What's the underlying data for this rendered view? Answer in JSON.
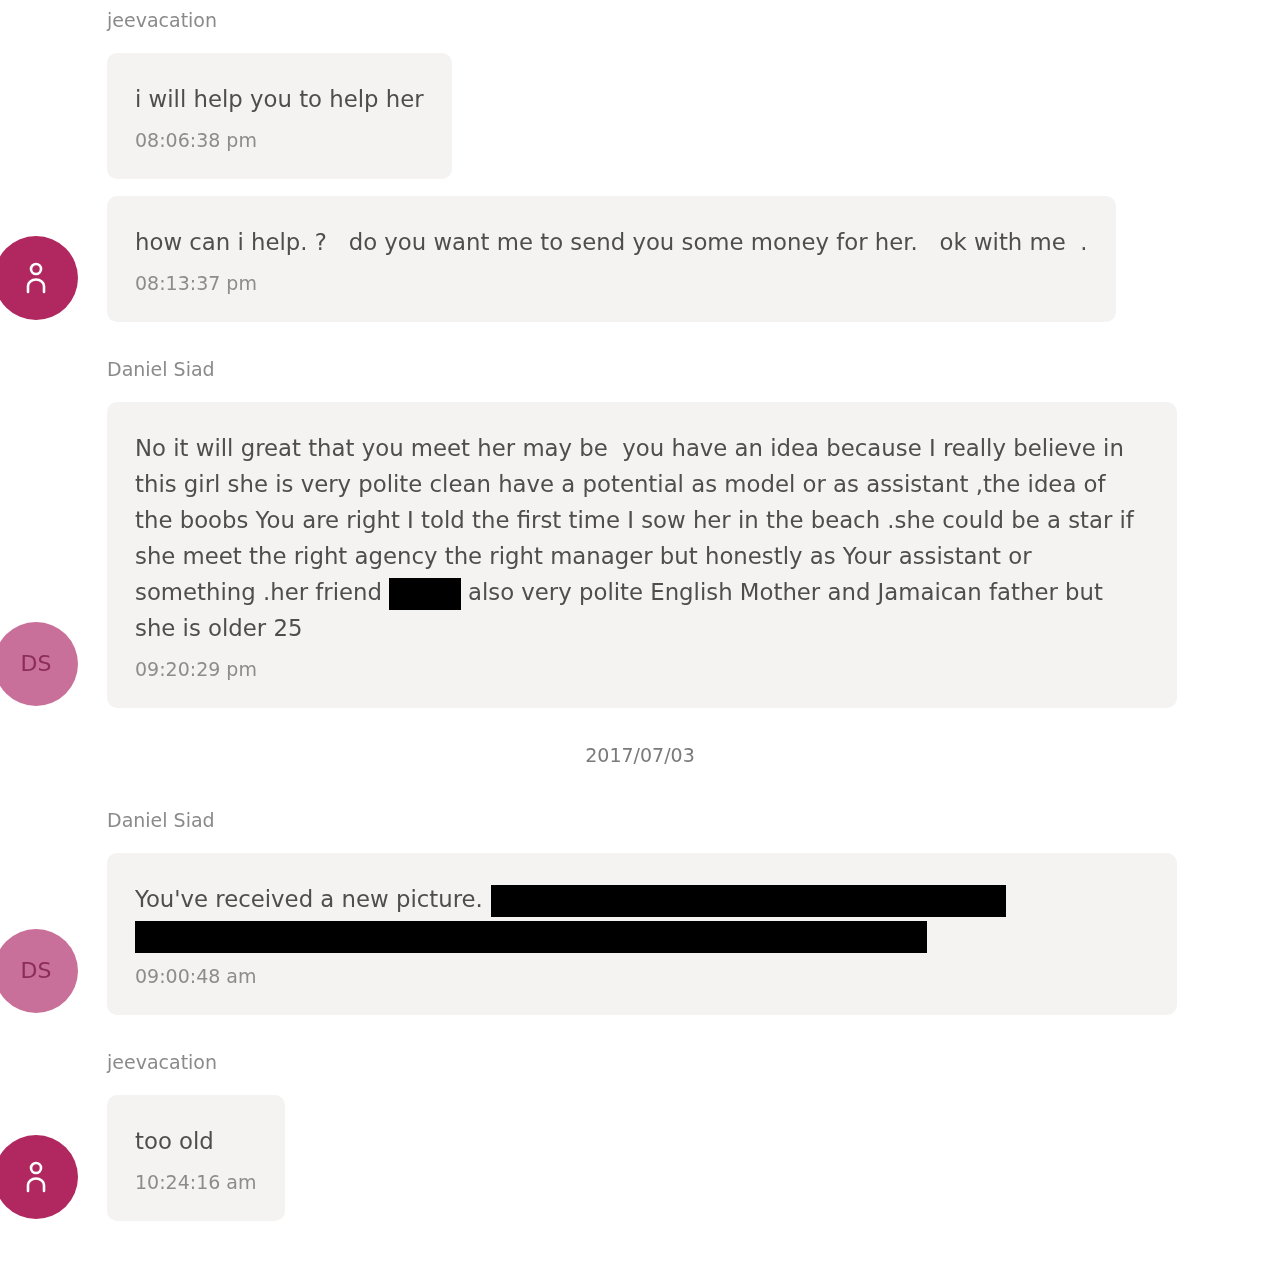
{
  "conversation": [
    {
      "kind": "group",
      "sender": "jeevacation",
      "avatar": {
        "kind": "icon",
        "color": "#b0285f"
      },
      "messages": [
        {
          "parts": [
            {
              "kind": "text",
              "text": "i will help you to help her"
            }
          ],
          "time": "08:06:38 pm"
        },
        {
          "parts": [
            {
              "kind": "text",
              "text": "how can i help. ?   do you want me to send you some money for her.   ok with me  ."
            }
          ],
          "time": "08:13:37 pm"
        }
      ]
    },
    {
      "kind": "group",
      "sender": "Daniel Siad",
      "avatar": {
        "kind": "initials",
        "initials": "DS",
        "color": "#c9709a"
      },
      "messages": [
        {
          "parts": [
            {
              "kind": "text",
              "text": "No it will great that you meet her may be  you have an idea because I really believe in this girl she is very polite clean have a potential as model or as assistant ,the idea of the boobs You are right I told the first time I sow her in the beach .she could be a star if she meet the right agency the right manager but honestly as Your assistant or something .her friend"
            },
            {
              "kind": "redacted_word"
            },
            {
              "kind": "text",
              "text": "also very polite English Mother and Jamaican father but she is older 25"
            }
          ],
          "time": "09:20:29 pm"
        }
      ]
    },
    {
      "kind": "date",
      "text": "2017/07/03"
    },
    {
      "kind": "group",
      "sender": "Daniel Siad",
      "avatar": {
        "kind": "initials",
        "initials": "DS",
        "color": "#c9709a"
      },
      "messages": [
        {
          "parts": [
            {
              "kind": "text",
              "text": "You've received a new picture."
            },
            {
              "kind": "redacted_line"
            },
            {
              "kind": "redacted_line"
            }
          ],
          "time": "09:00:48 am"
        }
      ]
    },
    {
      "kind": "group",
      "sender": "jeevacation",
      "avatar": {
        "kind": "icon",
        "color": "#b0285f"
      },
      "messages": [
        {
          "parts": [
            {
              "kind": "text",
              "text": "too old"
            }
          ],
          "time": "10:24:16 am"
        }
      ]
    }
  ]
}
